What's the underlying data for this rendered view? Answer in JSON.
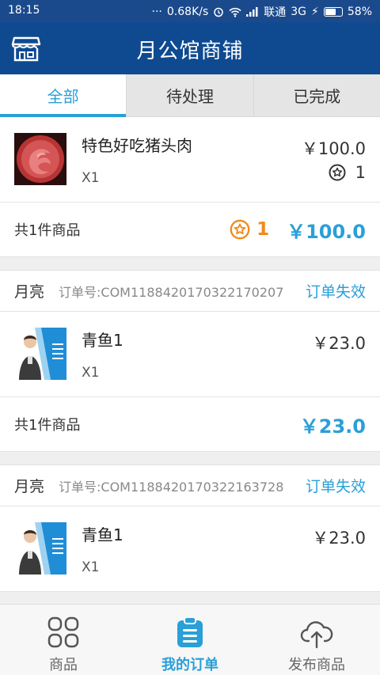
{
  "statusbar": {
    "time": "18:15",
    "speed": "0.68K/s",
    "carrier": "联通",
    "network": "3G",
    "battery": "58%"
  },
  "appbar": {
    "title": "月公馆商铺"
  },
  "tabs": [
    {
      "label": "全部",
      "active": true
    },
    {
      "label": "待处理",
      "active": false
    },
    {
      "label": "已完成",
      "active": false
    }
  ],
  "orders": [
    {
      "items": [
        {
          "name": "特色好吃猪头肉",
          "qty": "X1",
          "price": "￥100.0",
          "points": "1",
          "image": "rose-photo"
        }
      ],
      "summary": {
        "count": "共1件商品",
        "points": "1",
        "total": "￥100.0"
      }
    },
    {
      "shop": "月亮",
      "order_no": "订单号:COM1188420170322170207",
      "status": "订单失效",
      "items": [
        {
          "name": "青鱼1",
          "qty": "X1",
          "price": "￥23.0",
          "image": "poster-photo"
        }
      ],
      "summary": {
        "count": "共1件商品",
        "total": "￥23.0"
      }
    },
    {
      "shop": "月亮",
      "order_no": "订单号:COM1188420170322163728",
      "status": "订单失效",
      "items": [
        {
          "name": "青鱼1",
          "qty": "X1",
          "price": "￥23.0",
          "image": "poster-photo"
        }
      ]
    }
  ],
  "bottomnav": [
    {
      "label": "商品",
      "icon": "grid-icon",
      "active": false
    },
    {
      "label": "我的订单",
      "icon": "clipboard-icon",
      "active": true
    },
    {
      "label": "发布商品",
      "icon": "cloud-upload-icon",
      "active": false
    }
  ],
  "colors": {
    "primary": "#0f4a91",
    "accent": "#2a9fd8",
    "points": "#f08b1d"
  }
}
